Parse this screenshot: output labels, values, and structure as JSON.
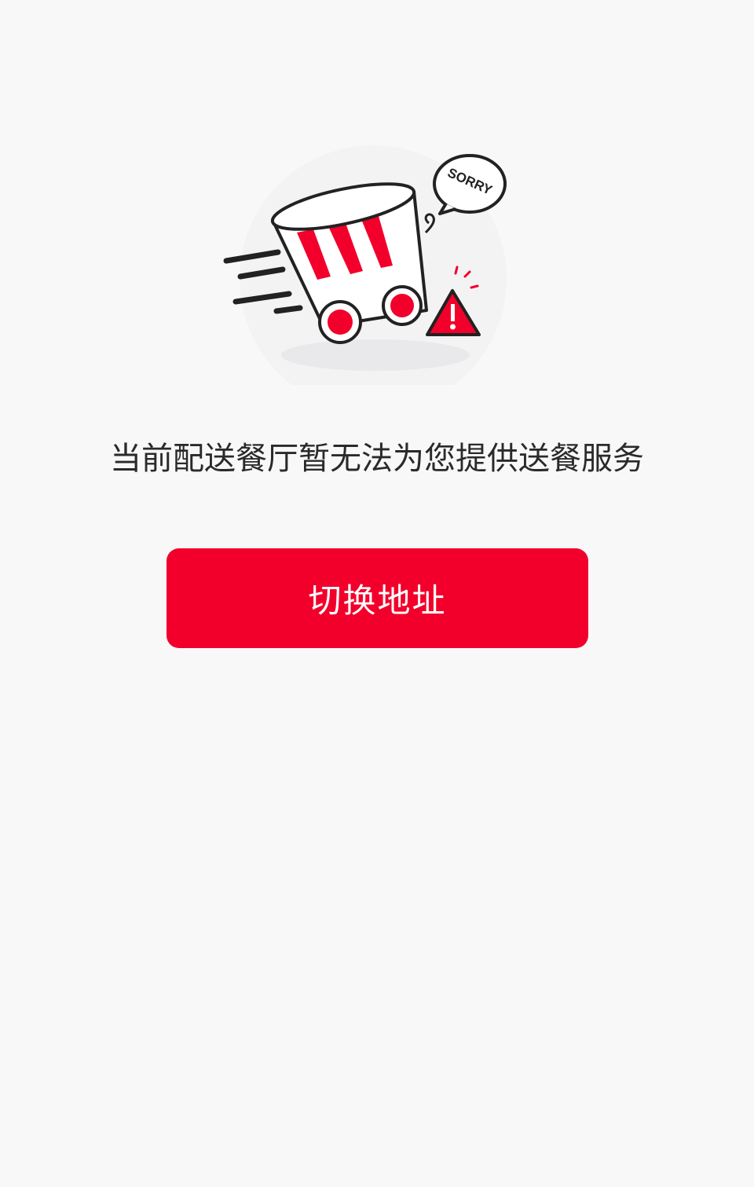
{
  "empty_state": {
    "illustration_icon": "sorry-bucket-cart-icon",
    "speech_bubble_text": "SORRY",
    "message": "当前配送餐厅暂无法为您提供送餐服务",
    "button_label": "切换地址"
  },
  "colors": {
    "accent": "#f2002b",
    "background": "#f8f8f9",
    "text": "#2a2a2a"
  }
}
